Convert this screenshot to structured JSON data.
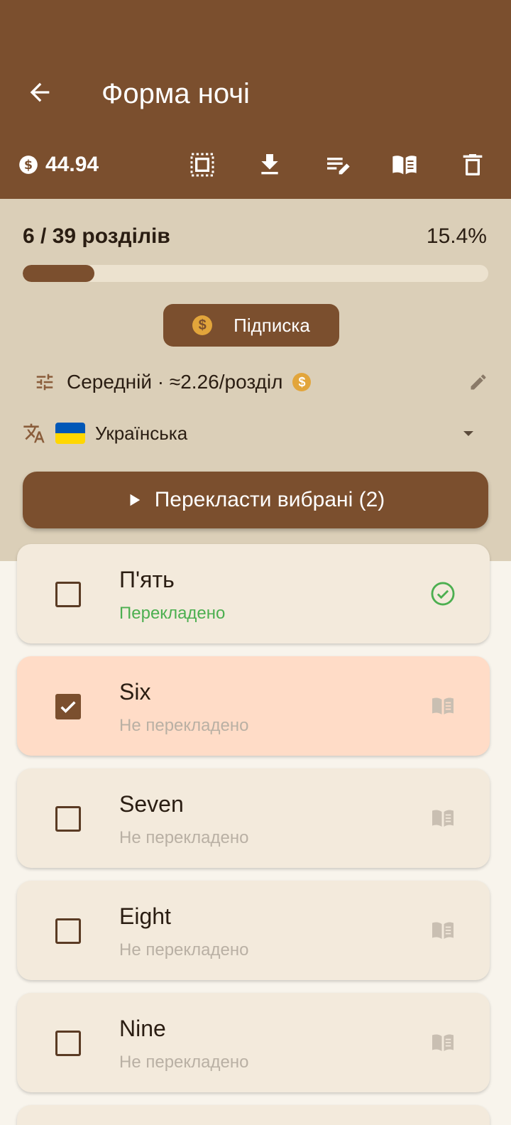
{
  "header": {
    "title": "Форма ночі",
    "balance": "44.94"
  },
  "progress": {
    "label": "6 / 39 розділів",
    "percent_text": "15.4%",
    "fraction": 0.154
  },
  "subscription": {
    "label": "Підписка"
  },
  "tier": {
    "text": "Середній · ≈2.26/розділ"
  },
  "language": {
    "name": "Українська"
  },
  "translate_button": {
    "label": "Перекласти вибрані (2)"
  },
  "chapters": [
    {
      "title": "П'ять",
      "status": "Перекладено",
      "translated": true,
      "selected": false
    },
    {
      "title": "Six",
      "status": "Не перекладено",
      "translated": false,
      "selected": true
    },
    {
      "title": "Seven",
      "status": "Не перекладено",
      "translated": false,
      "selected": false
    },
    {
      "title": "Eight",
      "status": "Не перекладено",
      "translated": false,
      "selected": false
    },
    {
      "title": "Nine",
      "status": "Не перекладено",
      "translated": false,
      "selected": false
    }
  ],
  "colors": {
    "primary": "#7b4f2e",
    "panel": "#dbcfb8",
    "card": "#f3eadc",
    "card_selected": "#ffdcc7",
    "success": "#4caf50",
    "coin": "#e2a53b"
  }
}
